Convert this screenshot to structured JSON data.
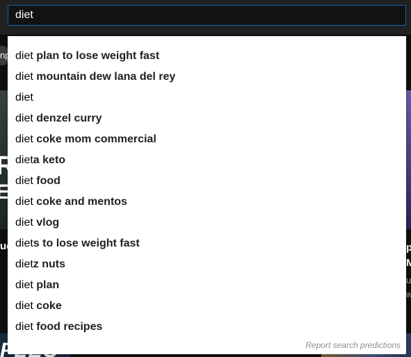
{
  "search": {
    "query": "diet"
  },
  "background": {
    "chip_left_text": "np",
    "thumb_left_line1": "R",
    "thumb_left_line2": "E",
    "left_title": "uc",
    "right_title_line1": "p",
    "right_title_line2": "M",
    "right_meta_line1": "u",
    "right_meta_line2": "w",
    "bottom_left_text": "FLES"
  },
  "suggestions": [
    {
      "prefix": "diet",
      "completion": " plan to lose weight fast"
    },
    {
      "prefix": "diet",
      "completion": " mountain dew lana del rey"
    },
    {
      "prefix": "diet",
      "completion": ""
    },
    {
      "prefix": "diet",
      "completion": " denzel curry"
    },
    {
      "prefix": "diet",
      "completion": " coke mom commercial"
    },
    {
      "prefix": "diet",
      "completion": "a keto"
    },
    {
      "prefix": "diet",
      "completion": " food"
    },
    {
      "prefix": "diet",
      "completion": " coke and mentos"
    },
    {
      "prefix": "diet",
      "completion": " vlog"
    },
    {
      "prefix": "diet",
      "completion": "s to lose weight fast"
    },
    {
      "prefix": "diet",
      "completion": "z nuts"
    },
    {
      "prefix": "diet",
      "completion": " plan"
    },
    {
      "prefix": "diet",
      "completion": " coke"
    },
    {
      "prefix": "diet",
      "completion": " food recipes"
    }
  ],
  "report_label": "Report search predictions",
  "colors": {
    "header_bg": "#202020",
    "search_border": "#1c62b9",
    "dropdown_bg": "#ffffff"
  }
}
